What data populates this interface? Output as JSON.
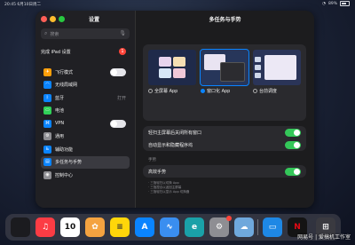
{
  "status": {
    "time": "20:45",
    "date": "6月10日周二",
    "battery": "89%"
  },
  "sidebar": {
    "title": "设置",
    "search_placeholder": "搜索",
    "setup_label": "完成 iPad 设置",
    "setup_badge": "1",
    "items": [
      {
        "label": "飞行模式",
        "icon": "airplane-icon",
        "color": "#ff9f0a",
        "toggle": "off"
      },
      {
        "label": "无线局域网",
        "icon": "wifi-icon",
        "color": "#0a84ff"
      },
      {
        "label": "蓝牙",
        "icon": "bluetooth-icon",
        "color": "#0a84ff",
        "value": "打开"
      },
      {
        "label": "电池",
        "icon": "battery-icon",
        "color": "#30d158"
      },
      {
        "label": "VPN",
        "icon": "vpn-icon",
        "color": "#0a84ff",
        "toggle": "off"
      },
      {
        "label": "通用",
        "icon": "gear-icon",
        "color": "#8e8e93"
      },
      {
        "label": "辅助功能",
        "icon": "accessibility-icon",
        "color": "#0a84ff"
      },
      {
        "label": "多任务与手势",
        "icon": "multitasking-icon",
        "color": "#0a84ff",
        "active": true
      },
      {
        "label": "控制中心",
        "icon": "control-center-icon",
        "color": "#8e8e93"
      }
    ]
  },
  "main": {
    "title": "多任务与手势",
    "options": [
      {
        "label": "全屏幕 App",
        "selected": false,
        "desc": ""
      },
      {
        "label": "窗口化 App",
        "selected": true,
        "desc": ""
      },
      {
        "label": "台前调度",
        "selected": false,
        "desc": ""
      }
    ],
    "row1": "轻扫主屏幕后关闭所有窗口",
    "row1_toggle": "on",
    "row2": "自动显示和隐藏程序坞",
    "row2_toggle": "on",
    "section": "手势",
    "row3": "高效手势",
    "row3_toggle": "on",
    "notes": [
      "· 三指轻扫以切换 App",
      "· 三指捏合以返回主屏幕",
      "· 三指轻扫以显示 App 切换器"
    ]
  },
  "dock": {
    "apps": [
      {
        "name": "Music",
        "icon": "music-icon",
        "glyph": "♫",
        "color": "#fc3c44"
      },
      {
        "name": "Calendar",
        "icon": "calendar-icon",
        "glyph": "10",
        "color": "#ffffff",
        "fg": "#111111"
      },
      {
        "name": "Photos",
        "icon": "photos-icon",
        "glyph": "✿",
        "color": "#f4a340"
      },
      {
        "name": "Notes",
        "icon": "notes-icon",
        "glyph": "≡",
        "color": "#ffd60a",
        "fg": "#333333"
      },
      {
        "name": "App Store",
        "icon": "app-store-icon",
        "glyph": "A",
        "color": "#0a84ff"
      },
      {
        "name": "Freeform",
        "icon": "freeform-icon",
        "glyph": "∿",
        "color": "#3a8ef0"
      },
      {
        "name": "Edge",
        "icon": "edge-icon",
        "glyph": "e",
        "color": "#1aa1a8"
      },
      {
        "name": "Settings",
        "icon": "settings-icon",
        "glyph": "⚙",
        "color": "#8e8e93"
      },
      {
        "name": "Weather",
        "icon": "weather-icon",
        "glyph": "☁",
        "color": "#6fa8dc"
      },
      {
        "name": "Files",
        "icon": "files-icon",
        "glyph": "▭",
        "color": "#1e88e5"
      },
      {
        "name": "Netflix",
        "icon": "netflix-icon",
        "glyph": "N",
        "color": "#141414",
        "fg": "#e50914"
      },
      {
        "name": "App Library",
        "icon": "app-library-icon",
        "glyph": "⊞",
        "color": "#3a3a40"
      }
    ]
  },
  "watermark": "网易号 | 爱搞机工作室"
}
